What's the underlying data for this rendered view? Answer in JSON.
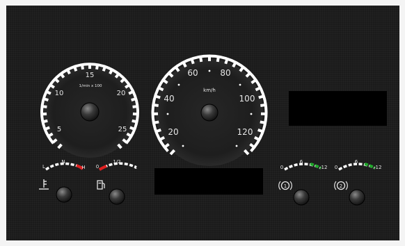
{
  "tachometer": {
    "unit": "1/min x 100",
    "ticks": [
      "5",
      "10",
      "15",
      "20",
      "25"
    ]
  },
  "speedometer": {
    "unit": "km/h",
    "ticks": [
      "20",
      "40",
      "60",
      "80",
      "100",
      "120"
    ]
  },
  "temperature_gauge": {
    "low": "L",
    "mid": "N",
    "high": "H",
    "icon": "coolant-temperature-icon"
  },
  "fuel_gauge": {
    "low": "0",
    "mid": "1/2",
    "high": "1",
    "icon": "fuel-pump-icon"
  },
  "brake_pressure_gauge_1": {
    "low": "0",
    "mid": "6",
    "high": "12",
    "icon": "brake-circuit-1-icon"
  },
  "brake_pressure_gauge_2": {
    "low": "0",
    "mid": "6",
    "high": "12",
    "icon": "brake-circuit-2-icon"
  },
  "colors": {
    "background": "#1b1b1b",
    "scale": "#ffffff",
    "warning": "#e02020",
    "ok": "#1fa82a",
    "display": "#000000"
  }
}
